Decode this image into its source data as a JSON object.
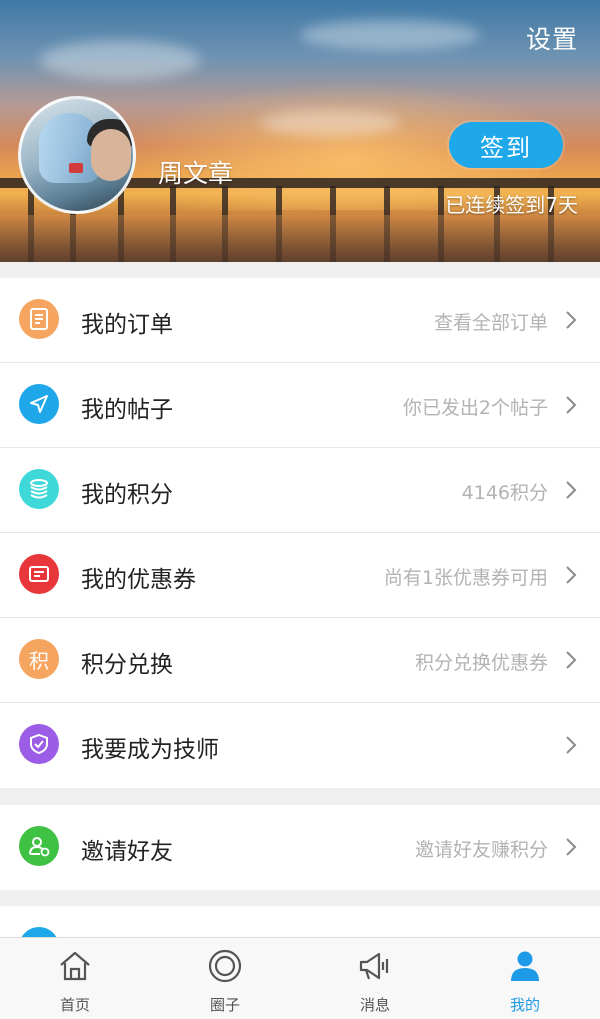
{
  "header": {
    "settings_label": "设置",
    "username": "周文章",
    "checkin_button": "签到",
    "checkin_status": "已连续签到7天"
  },
  "menu_group_1": [
    {
      "label": "我的订单",
      "detail": "查看全部订单",
      "icon": "order-icon",
      "icon_color": "#f5a55f"
    },
    {
      "label": "我的帖子",
      "detail": "你已发出2个帖子",
      "icon": "send-icon",
      "icon_color": "#1ea8ea"
    },
    {
      "label": "我的积分",
      "detail": "4146积分",
      "icon": "coins-icon",
      "icon_color": "#3ed8d8"
    },
    {
      "label": "我的优惠券",
      "detail": "尚有1张优惠券可用",
      "icon": "coupon-icon",
      "icon_color": "#e8373a"
    },
    {
      "label": "积分兑换",
      "detail": "积分兑换优惠券",
      "icon": "exchange-icon",
      "icon_color": "#f5a55f",
      "icon_glyph": "积"
    },
    {
      "label": "我要成为技师",
      "detail": "",
      "icon": "shield-icon",
      "icon_color": "#9b5de5"
    }
  ],
  "menu_group_2": [
    {
      "label": "邀请好友",
      "detail": "邀请好友赚积分",
      "icon": "invite-friend-icon",
      "icon_color": "#3fc244"
    }
  ],
  "bottom_nav": [
    {
      "label": "首页",
      "icon": "home-icon",
      "active": false
    },
    {
      "label": "圈子",
      "icon": "circle-icon",
      "active": false
    },
    {
      "label": "消息",
      "icon": "megaphone-icon",
      "active": false
    },
    {
      "label": "我的",
      "icon": "user-icon",
      "active": true
    }
  ],
  "colors": {
    "accent": "#1e9be6",
    "checkin_button": "#1ea8ea"
  }
}
